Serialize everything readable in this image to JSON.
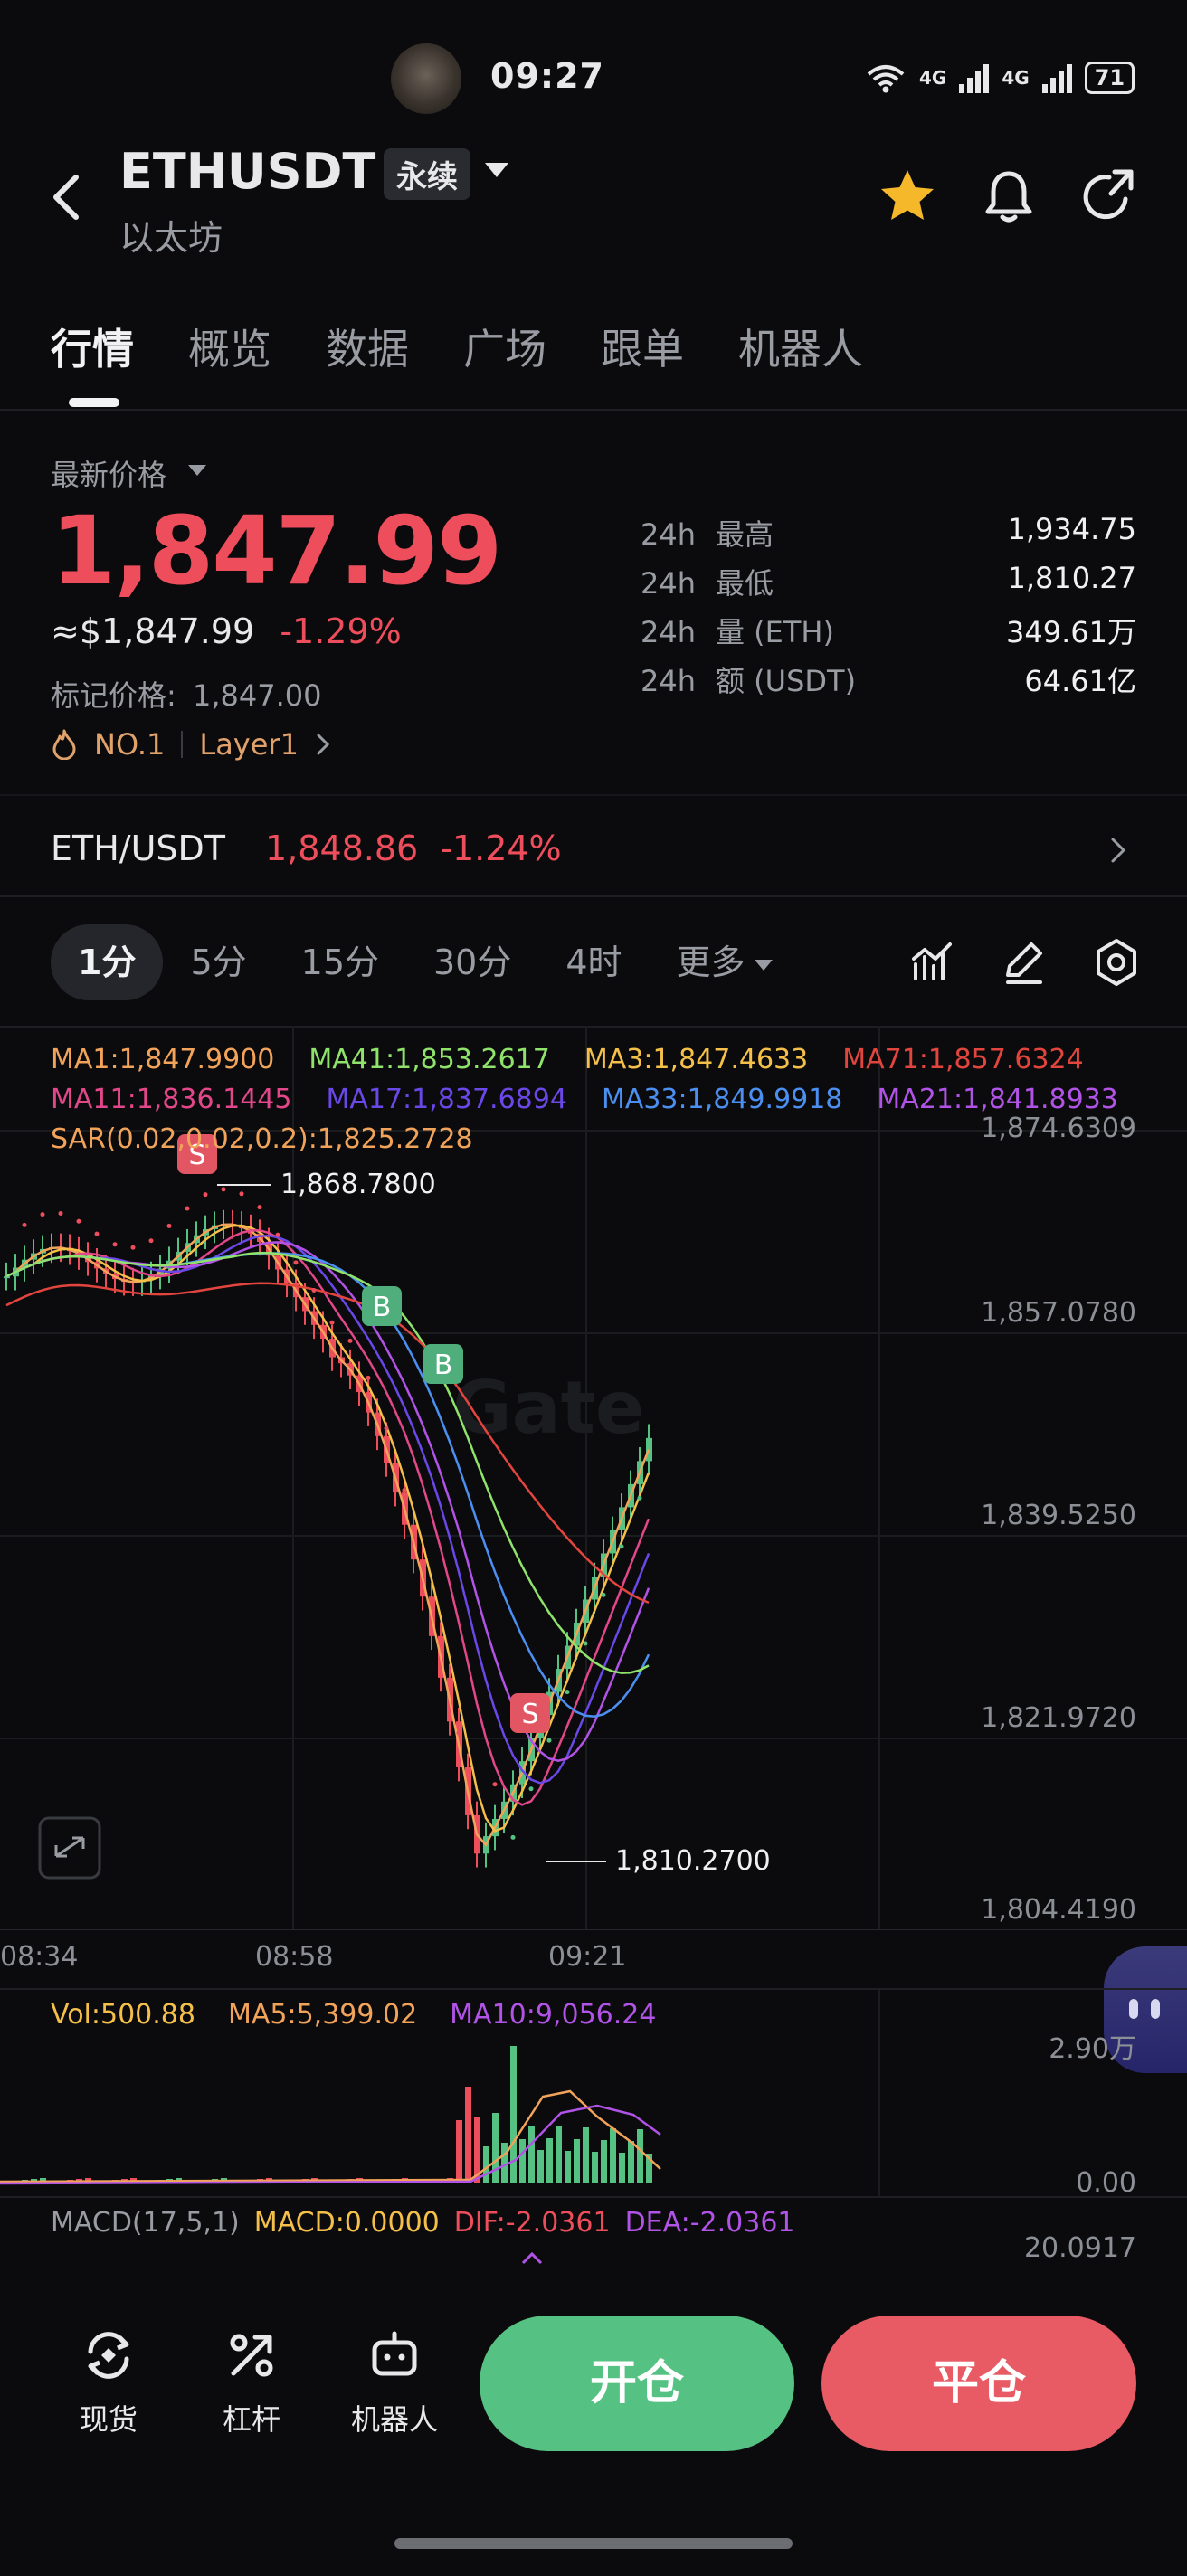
{
  "status_bar": {
    "time": "09:27",
    "network": "4G",
    "network2": "4G",
    "wifi_label": "6",
    "battery": "71"
  },
  "header": {
    "symbol": "ETHUSDT",
    "contract_type": "永续",
    "coin_name": "以太坊"
  },
  "tabs": [
    {
      "label": "行情",
      "active": true
    },
    {
      "label": "概览"
    },
    {
      "label": "数据"
    },
    {
      "label": "广场"
    },
    {
      "label": "跟单"
    },
    {
      "label": "机器人"
    }
  ],
  "price": {
    "label": "最新价格",
    "last": "1,847.99",
    "usd": "≈$1,847.99",
    "change": "-1.29%",
    "mark_label": "标记价格:",
    "mark_value": "1,847.00",
    "rank": "NO.1",
    "category": "Layer1"
  },
  "stats": [
    {
      "prefix": "24h",
      "label": "最高",
      "value": "1,934.75"
    },
    {
      "prefix": "24h",
      "label": "最低",
      "value": "1,810.27"
    },
    {
      "prefix": "24h",
      "label": "量 (ETH)",
      "value": "349.61万"
    },
    {
      "prefix": "24h",
      "label": "额 (USDT)",
      "value": "64.61亿"
    }
  ],
  "spot": {
    "pair": "ETH/USDT",
    "price": "1,848.86",
    "change": "-1.24%"
  },
  "intervals": [
    "1分",
    "5分",
    "15分",
    "30分",
    "4时",
    "更多"
  ],
  "active_interval": "1分",
  "chart": {
    "ma_row1": [
      {
        "text": "MA1:1,847.9900",
        "color": "#f2a35a"
      },
      {
        "text": "MA41:1,853.2617",
        "color": "#8fe36a"
      },
      {
        "text": "MA3:1,847.4633",
        "color": "#f5c04a"
      },
      {
        "text": "MA71:1,857.6324",
        "color": "#e2453e"
      }
    ],
    "ma_row2": [
      {
        "text": "MA11:1,836.1445",
        "color": "#e2478a"
      },
      {
        "text": "MA17:1,837.6894",
        "color": "#6a48e8"
      },
      {
        "text": "MA33:1,849.9918",
        "color": "#4b8ff0"
      },
      {
        "text": "MA21:1,841.8933",
        "color": "#b153e6"
      }
    ],
    "sar": "SAR(0.02,0.02,0.2):1,825.2728",
    "high_label": "1,868.7800",
    "low_label": "1,810.2700",
    "markers": [
      "S",
      "B",
      "B",
      "S"
    ],
    "y_ticks": [
      "1,874.6309",
      "1,857.0780",
      "1,839.5250",
      "1,821.9720",
      "1,804.4190"
    ],
    "x_ticks": [
      "08:34",
      "08:58",
      "09:21"
    ],
    "volume": {
      "vol": "Vol:500.88",
      "ma5": "MA5:5,399.02",
      "ma10": "MA10:9,056.24",
      "top": "2.90万",
      "bottom": "0.00"
    },
    "macd": {
      "title": "MACD(17,5,1)",
      "macd": "MACD:0.0000",
      "dif": "DIF:-2.0361",
      "dea": "DEA:-2.0361",
      "top": "20.0917"
    },
    "colors": {
      "up": "#55c283",
      "down": "#ee4e5c"
    }
  },
  "bottom_nav": [
    {
      "label": "现货",
      "icon": "spot-icon"
    },
    {
      "label": "杠杆",
      "icon": "margin-icon"
    },
    {
      "label": "机器人",
      "icon": "robot-icon"
    }
  ],
  "actions": {
    "open": "开仓",
    "close": "平仓",
    "open_color": "#55c283",
    "close_color": "#e85a64"
  }
}
